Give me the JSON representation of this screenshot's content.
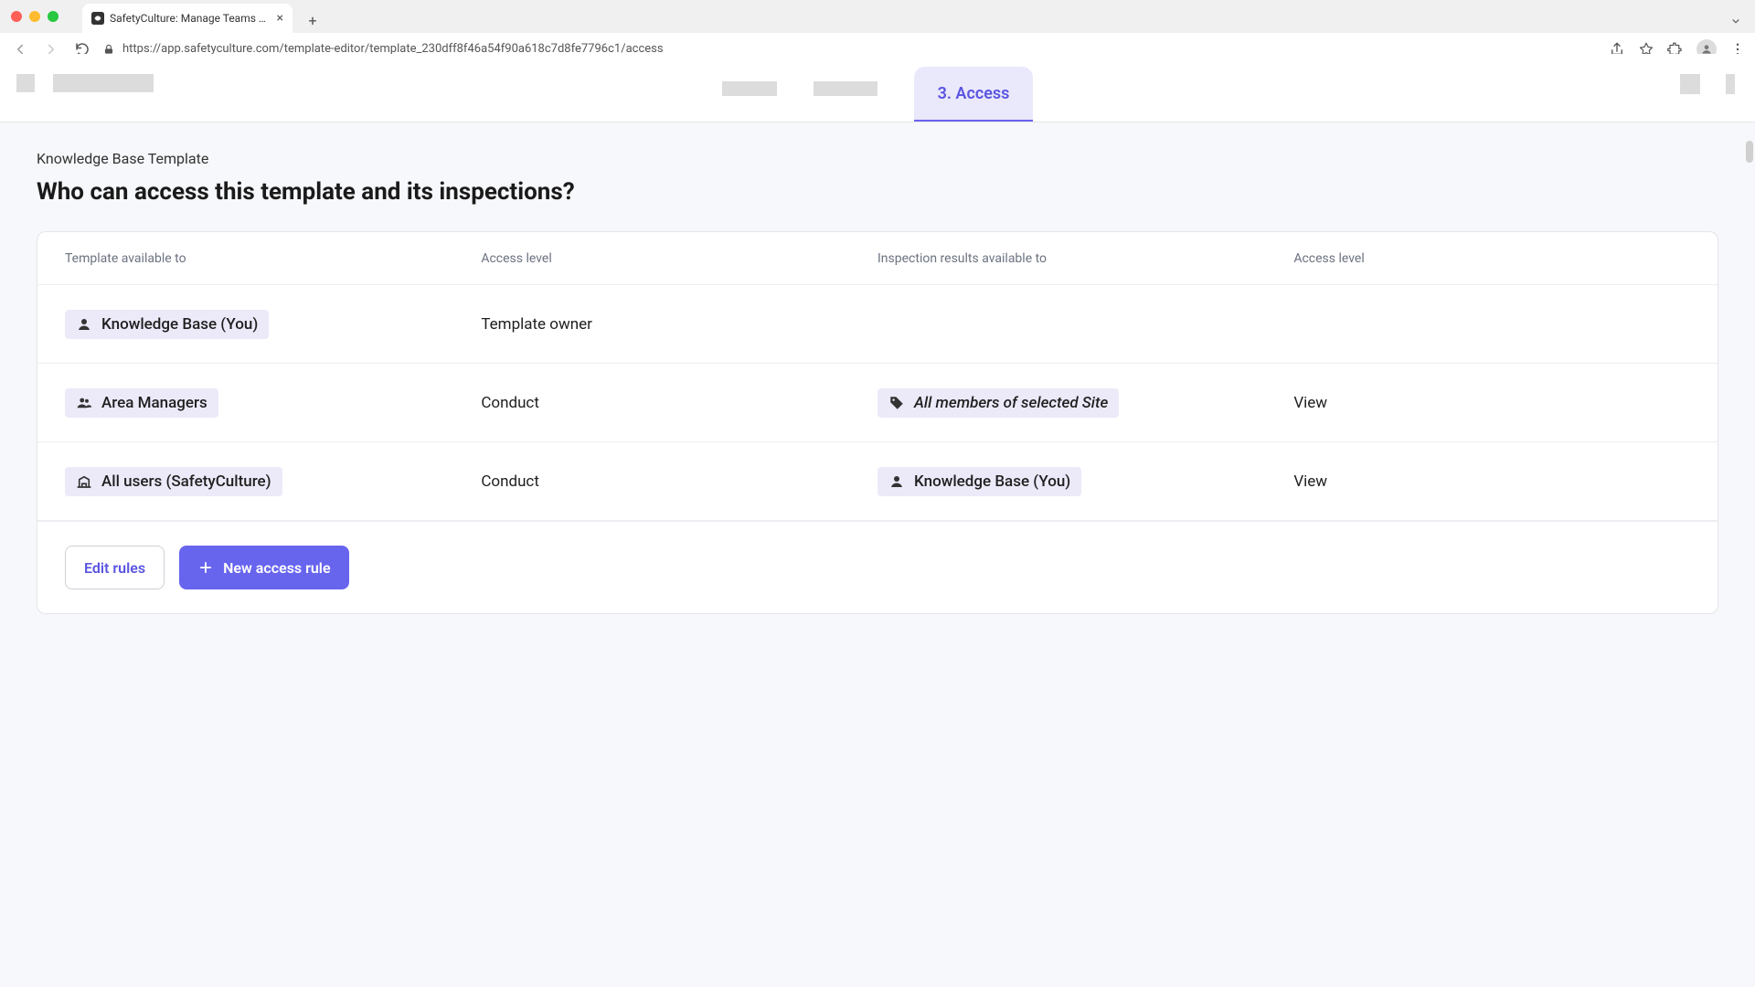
{
  "browser": {
    "tab_title": "SafetyCulture: Manage Teams and ...",
    "url": "https://app.safetyculture.com/template-editor/template_230dff8f46a54f90a618c7d8fe7796c1/access"
  },
  "header": {
    "active_tab_label": "3. Access"
  },
  "page": {
    "breadcrumb": "Knowledge Base Template",
    "title": "Who can access this template and its inspections?"
  },
  "table": {
    "headers": {
      "template_available_to": "Template available to",
      "access_level_left": "Access level",
      "results_available_to": "Inspection results available to",
      "access_level_right": "Access level"
    },
    "rows": [
      {
        "subject": "Knowledge Base (You)",
        "subject_icon": "person",
        "access_left": "Template owner",
        "result_subject": "",
        "result_icon": "",
        "access_right": ""
      },
      {
        "subject": "Area Managers",
        "subject_icon": "group",
        "access_left": "Conduct",
        "result_subject": "All members of selected Site",
        "result_icon": "tag",
        "result_italic": true,
        "access_right": "View"
      },
      {
        "subject": "All users (SafetyCulture)",
        "subject_icon": "org",
        "access_left": "Conduct",
        "result_subject": "Knowledge Base (You)",
        "result_icon": "person",
        "access_right": "View"
      }
    ]
  },
  "actions": {
    "edit_rules": "Edit rules",
    "new_rule": "New access rule"
  }
}
